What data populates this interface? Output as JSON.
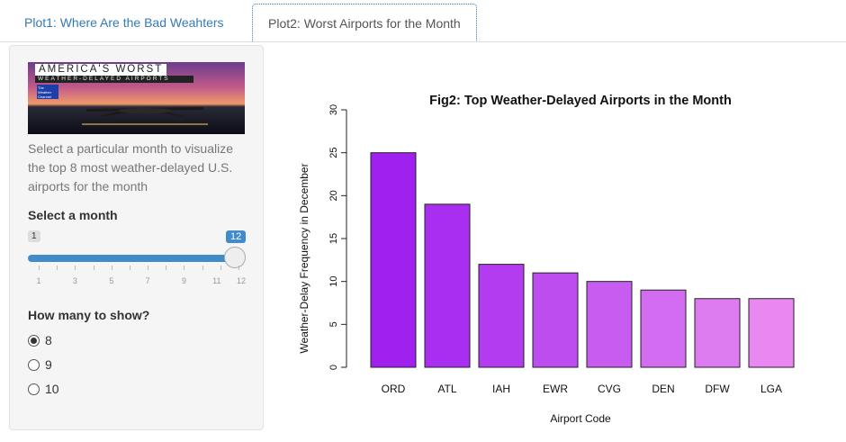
{
  "tabs": [
    {
      "label": "Plot1: Where Are the Bad Weahters",
      "active": false
    },
    {
      "label": "Plot2: Worst Airports for the Month",
      "active": true
    }
  ],
  "banner": {
    "title": "AMERICA'S WORST",
    "subtitle": "WEATHER-DELAYED AIRPORTS",
    "logo_text": "The Weather Channel"
  },
  "sidebar": {
    "description": "Select a particular month to visualize the top 8 most weather-delayed U.S. airports for the month",
    "month_label": "Select a month",
    "slider": {
      "min": "1",
      "max": "12",
      "value": "12",
      "tick_labels": [
        "1",
        "3",
        "5",
        "7",
        "9",
        "11",
        "12"
      ]
    },
    "count_label": "How many to show?",
    "options": [
      {
        "label": "8",
        "selected": true
      },
      {
        "label": "9",
        "selected": false
      },
      {
        "label": "10",
        "selected": false
      }
    ]
  },
  "chart_data": {
    "type": "bar",
    "title": "Fig2: Top Weather-Delayed Airports in the Month",
    "xlabel": "Airport Code",
    "ylabel": "Weather-Delay Frequency in December",
    "categories": [
      "ORD",
      "ATL",
      "IAH",
      "EWR",
      "CVG",
      "DEN",
      "DFW",
      "LGA"
    ],
    "values": [
      25,
      19,
      12,
      11,
      10,
      9,
      8,
      8
    ],
    "ylim": [
      0,
      30
    ],
    "yticks": [
      0,
      5,
      10,
      15,
      20,
      25,
      30
    ],
    "colors": [
      "#a020f0",
      "#aa2ef0",
      "#b43cf0",
      "#be4df0",
      "#c85cf0",
      "#d26cf0",
      "#dc7cf0",
      "#e888f0"
    ]
  }
}
